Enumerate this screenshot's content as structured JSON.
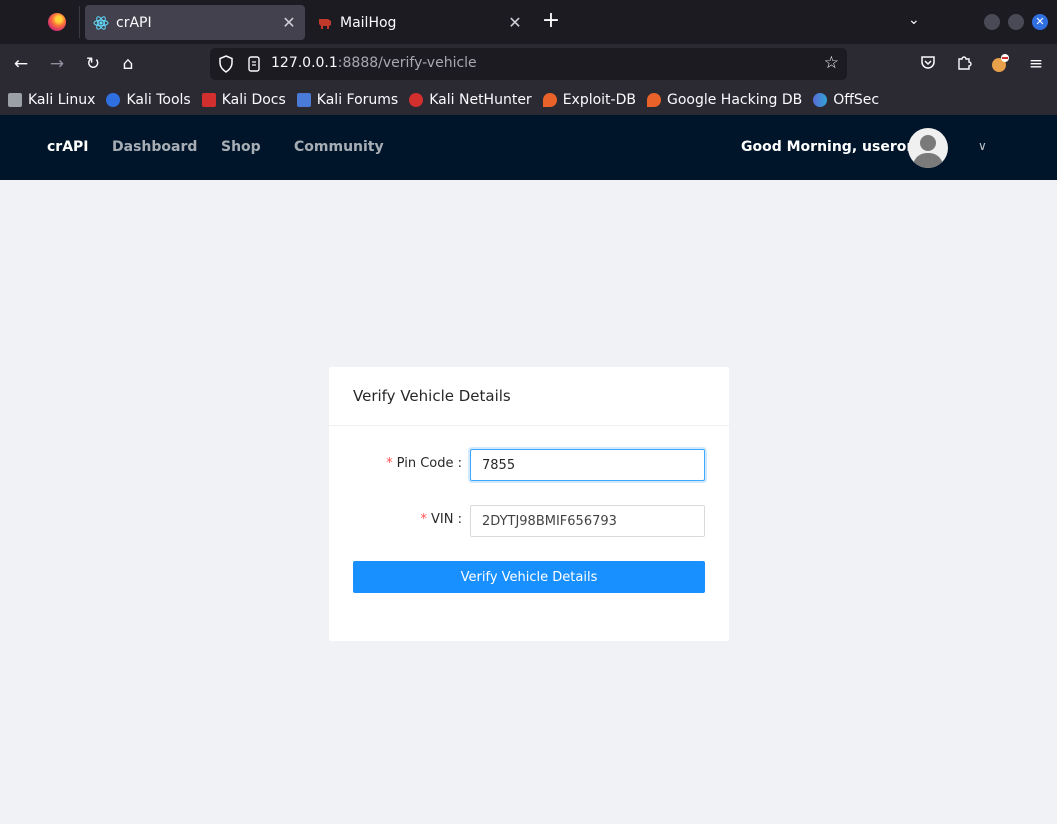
{
  "browser": {
    "tabs": [
      {
        "title": "crAPI",
        "close": "✕"
      },
      {
        "title": "MailHog",
        "close": "✕"
      }
    ],
    "new_tab": "+",
    "list_tabs": "⌄",
    "url_host": "127.0.0.1",
    "url_rest": ":8888/verify-vehicle",
    "bookmarks": [
      {
        "label": "Kali Linux",
        "color": "#9aa0a6"
      },
      {
        "label": "Kali Tools",
        "color": "#2f6fe0"
      },
      {
        "label": "Kali Docs",
        "color": "#d32f2f"
      },
      {
        "label": "Kali Forums",
        "color": "#4a7bd6"
      },
      {
        "label": "Kali NetHunter",
        "color": "#d32f2f"
      },
      {
        "label": "Exploit-DB",
        "color": "#e8622a"
      },
      {
        "label": "Google Hacking DB",
        "color": "#e8622a"
      },
      {
        "label": "OffSec",
        "color": "#5b6bd6"
      }
    ],
    "icons": {
      "back": "←",
      "forward": "→",
      "reload": "↻",
      "home": "⌂",
      "star": "☆",
      "pocket": "◡",
      "extensions": "⧉",
      "menu": "≡"
    }
  },
  "app": {
    "brand": "crAPI",
    "nav": [
      "Dashboard",
      "Shop",
      "Community"
    ],
    "greeting": "Good Morning, userone!",
    "caret": "∨",
    "colors": {
      "header_bg": "#001529",
      "primary": "#1890ff",
      "required": "#ff4d4f"
    }
  },
  "form": {
    "title": "Verify Vehicle Details",
    "pin_label": "Pin Code",
    "pin_value": "7855",
    "vin_label": "VIN",
    "vin_value": "2DYTJ98BMIF656793",
    "required_mark": "*",
    "submit": "Verify Vehicle Details"
  }
}
